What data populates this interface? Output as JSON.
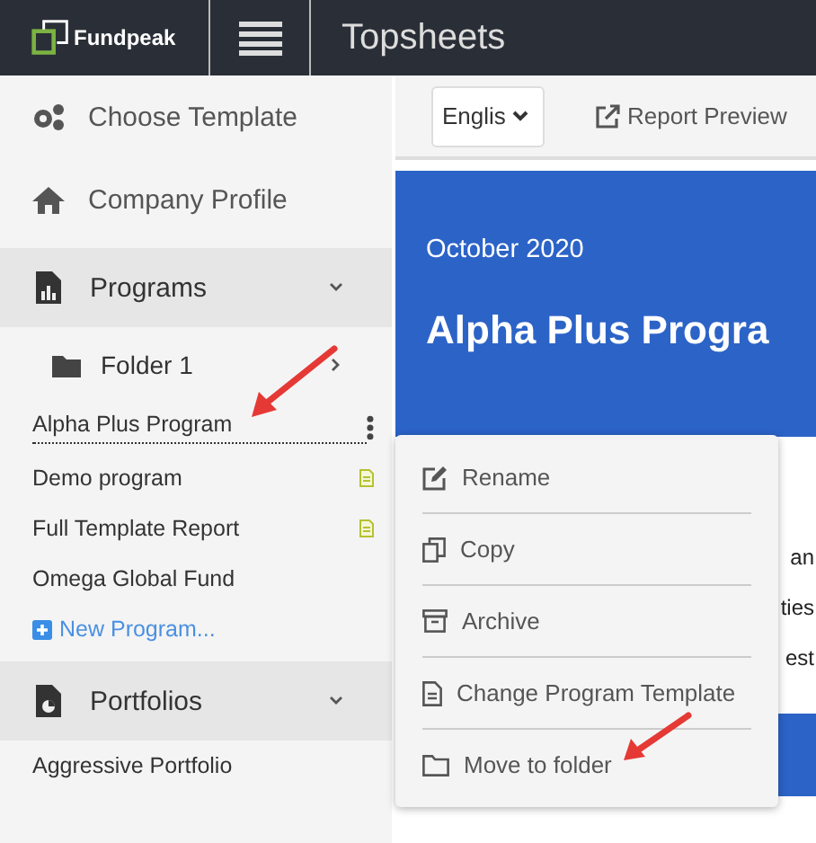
{
  "topbar": {
    "logo": "Fundpeak",
    "title": "Topsheets"
  },
  "sidebar": {
    "items": [
      {
        "kind": "link",
        "label": "Choose Template"
      },
      {
        "kind": "link",
        "label": "Company Profile"
      },
      {
        "kind": "section",
        "label": "Programs",
        "expanded": true,
        "folders": [
          {
            "label": "Folder 1",
            "expanded": false
          }
        ],
        "programs": [
          {
            "label": "Alpha Plus Program",
            "selected": true,
            "report": false
          },
          {
            "label": "Demo program",
            "selected": false,
            "report": true
          },
          {
            "label": "Full Template Report",
            "selected": false,
            "report": true
          },
          {
            "label": "Omega Global Fund",
            "selected": false,
            "report": false
          }
        ],
        "new_label": "New Program..."
      },
      {
        "kind": "section",
        "label": "Portfolios",
        "expanded": true,
        "programs": [
          {
            "label": "Aggressive Portfolio",
            "selected": false,
            "report": false
          }
        ]
      }
    ]
  },
  "toolbar": {
    "language": "Englis",
    "preview": "Report Preview"
  },
  "banner": {
    "date": "October  2020",
    "title": "Alpha Plus Progra"
  },
  "body_fragments": [
    "an",
    "ties",
    "est"
  ],
  "context_menu": [
    {
      "label": "Rename"
    },
    {
      "label": "Copy"
    },
    {
      "label": "Archive"
    },
    {
      "label": "Change Program Template"
    },
    {
      "label": "Move to folder"
    }
  ]
}
